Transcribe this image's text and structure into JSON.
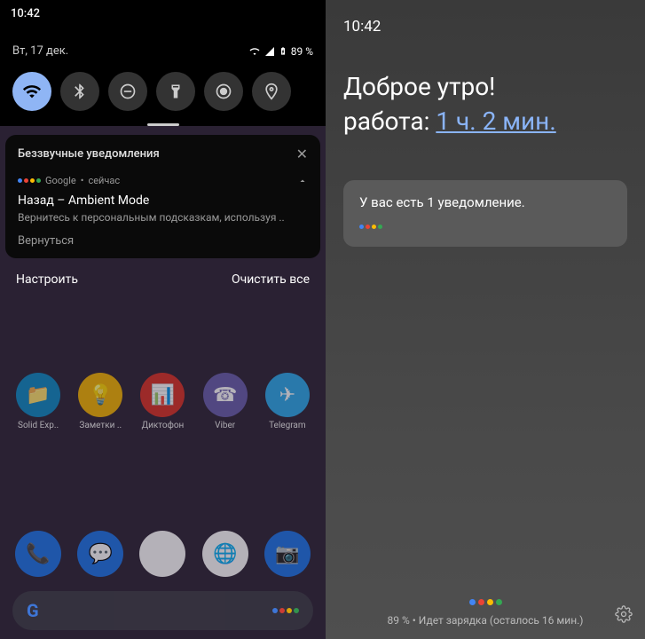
{
  "left": {
    "time": "10:42",
    "date": "Вт, 17 дек.",
    "battery": "89 %",
    "qs_icons": [
      "wifi",
      "bluetooth",
      "dnd",
      "flashlight",
      "autorotate",
      "location"
    ],
    "silent_header": "Беззвучные уведомления",
    "notif": {
      "app": "Google",
      "when": "сейчас",
      "title": "Назад – Ambient Mode",
      "body": "Вернитесь к персональным подсказкам, используя ..",
      "action": "Вернуться"
    },
    "manage": "Настроить",
    "clear_all": "Очистить все",
    "apps": [
      {
        "label": "Solid Exp..",
        "color": "#0a88c4"
      },
      {
        "label": "Заметки ..",
        "color": "#f4b400"
      },
      {
        "label": "Диктофон",
        "color": "#d93025"
      },
      {
        "label": "Viber",
        "color": "#665cac"
      },
      {
        "label": "Telegram",
        "color": "#29a9eb"
      }
    ],
    "dock": [
      {
        "name": "phone",
        "color": "#1a73e8"
      },
      {
        "name": "messages",
        "color": "#1a73e8"
      },
      {
        "name": "playstore",
        "color": "#fff"
      },
      {
        "name": "chrome",
        "color": "#fff"
      },
      {
        "name": "camera",
        "color": "#1a73e8"
      }
    ]
  },
  "right": {
    "time": "10:42",
    "greeting": "Доброе утро!",
    "commute_label": "работа:",
    "commute_value": "1 ч. 2 мин.",
    "notif_text": "У вас есть 1 уведомление.",
    "charging": "89 % • Идет зарядка (осталось 16 мин.)"
  }
}
